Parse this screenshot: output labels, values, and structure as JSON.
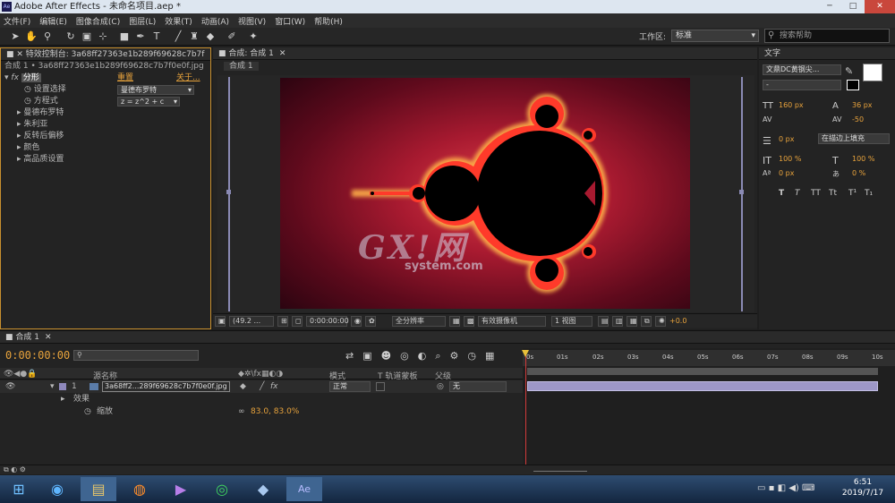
{
  "window": {
    "title": "Adobe After Effects - 未命名项目.aep *",
    "icon": "Ae"
  },
  "menu": [
    "文件(F)",
    "编辑(E)",
    "图像合成(C)",
    "图层(L)",
    "效果(T)",
    "动画(A)",
    "视图(V)",
    "窗口(W)",
    "帮助(H)"
  ],
  "toolbar": {
    "workspace_label": "工作区:",
    "workspace_value": "标准",
    "search_placeholder": "搜索帮助"
  },
  "effects_panel": {
    "tab": "特效控制台: 3a68ff27363e1b289f69628c7b7f",
    "subtitle": "合成 1 • 3a68ff27363e1b289f69628c7b7f0e0f.jpg",
    "effect_name": "分形",
    "reset": "重置",
    "about": "关于...",
    "rows": [
      {
        "label": "设置选择",
        "value": "曼德布罗特"
      },
      {
        "label": "方程式",
        "value": "z = z^2 + c"
      }
    ],
    "groups": [
      "曼德布罗特",
      "朱利亚",
      "反转后偏移",
      "颜色",
      "高品质设置"
    ]
  },
  "comp_panel": {
    "tab": "合成: 合成 1",
    "subtab": "合成 1",
    "viewer": {
      "zoom": "(49.2 ...",
      "time": "0:00:00:00",
      "resolution": "全分辨率",
      "camera": "有效摄像机",
      "views": "1 视图",
      "exposure": "+0.0"
    }
  },
  "char_panel": {
    "tab": "文字",
    "font": "文鼎DC黄钢尖...",
    "style": "-",
    "size": "160 px",
    "leading": "36 px",
    "tracking": "-50",
    "stroke_width": "0 px",
    "stroke_mode": "在描边上填充",
    "v_scale": "100 %",
    "h_scale": "100 %",
    "baseline": "0 px",
    "tsume": "0 %",
    "styles": [
      "T",
      "T",
      "TT",
      "Tt",
      "T¹",
      "T₁"
    ]
  },
  "timeline": {
    "tab": "合成 1",
    "timecode": "0:00:00:00",
    "columns": {
      "name": "源名称",
      "mode": "模式",
      "trkmat": "T 轨道蒙板",
      "parent": "父级"
    },
    "layer": {
      "index": "1",
      "name": "3a68ff2...289f69628c7b7f0e0f.jpg",
      "mode": "正常",
      "parent": "无"
    },
    "effect_group": "效果",
    "scale_label": "缩放",
    "scale_value": "83.0, 83.0%",
    "ruler": [
      "0s",
      "01s",
      "02s",
      "03s",
      "04s",
      "05s",
      "06s",
      "07s",
      "08s",
      "09s",
      "10s"
    ]
  },
  "taskbar": {
    "time": "6:51",
    "date": "2019/7/17"
  },
  "colors": {
    "accent": "#e8a33c",
    "layer_bar": "#9d97c7",
    "panel_border": "#c8902f"
  }
}
